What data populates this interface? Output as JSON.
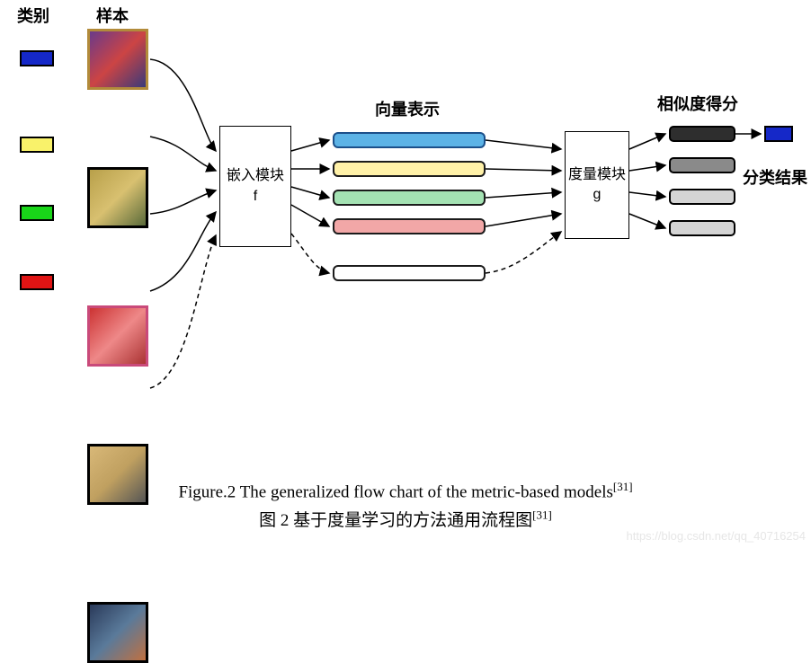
{
  "headers": {
    "category": "类别",
    "sample": "样本",
    "vector": "向量表示",
    "similarity": "相似度得分",
    "result": "分类结果"
  },
  "classes": [
    {
      "color": "#1528c8"
    },
    {
      "color": "#f9f26a"
    },
    {
      "color": "#19d619"
    },
    {
      "color": "#e01414"
    }
  ],
  "samples": [
    {
      "border": "#b28b3a"
    },
    {
      "border": "#000000"
    },
    {
      "border": "#c94a7a"
    },
    {
      "border": "#000000"
    },
    {
      "border": "#000000"
    }
  ],
  "modules": {
    "embed": {
      "title": "嵌入模块",
      "sub": "f"
    },
    "metric": {
      "title": "度量模块",
      "sub": "g"
    }
  },
  "vectors": [
    {
      "fill": "#5cb3e6",
      "stroke": "#1b4f8a"
    },
    {
      "fill": "#fff1a8",
      "stroke": "#1b1b1b"
    },
    {
      "fill": "#a4e2b3",
      "stroke": "#1b1b1b"
    },
    {
      "fill": "#f2a7a7",
      "stroke": "#1b1b1b"
    },
    {
      "fill": "#ffffff",
      "stroke": "#1b1b1b"
    }
  ],
  "scores": [
    {
      "fill": "#2e2e2e"
    },
    {
      "fill": "#8a8a8a"
    },
    {
      "fill": "#d4d4d4"
    },
    {
      "fill": "#d4d4d4"
    }
  ],
  "resultSwatch": "#1528c8",
  "caption": {
    "en": "Figure.2 The generalized flow chart of the metric-based models",
    "zh": "图 2 基于度量学习的方法通用流程图",
    "ref": "[31]"
  },
  "watermark": "https://blog.csdn.net/qq_40716254"
}
